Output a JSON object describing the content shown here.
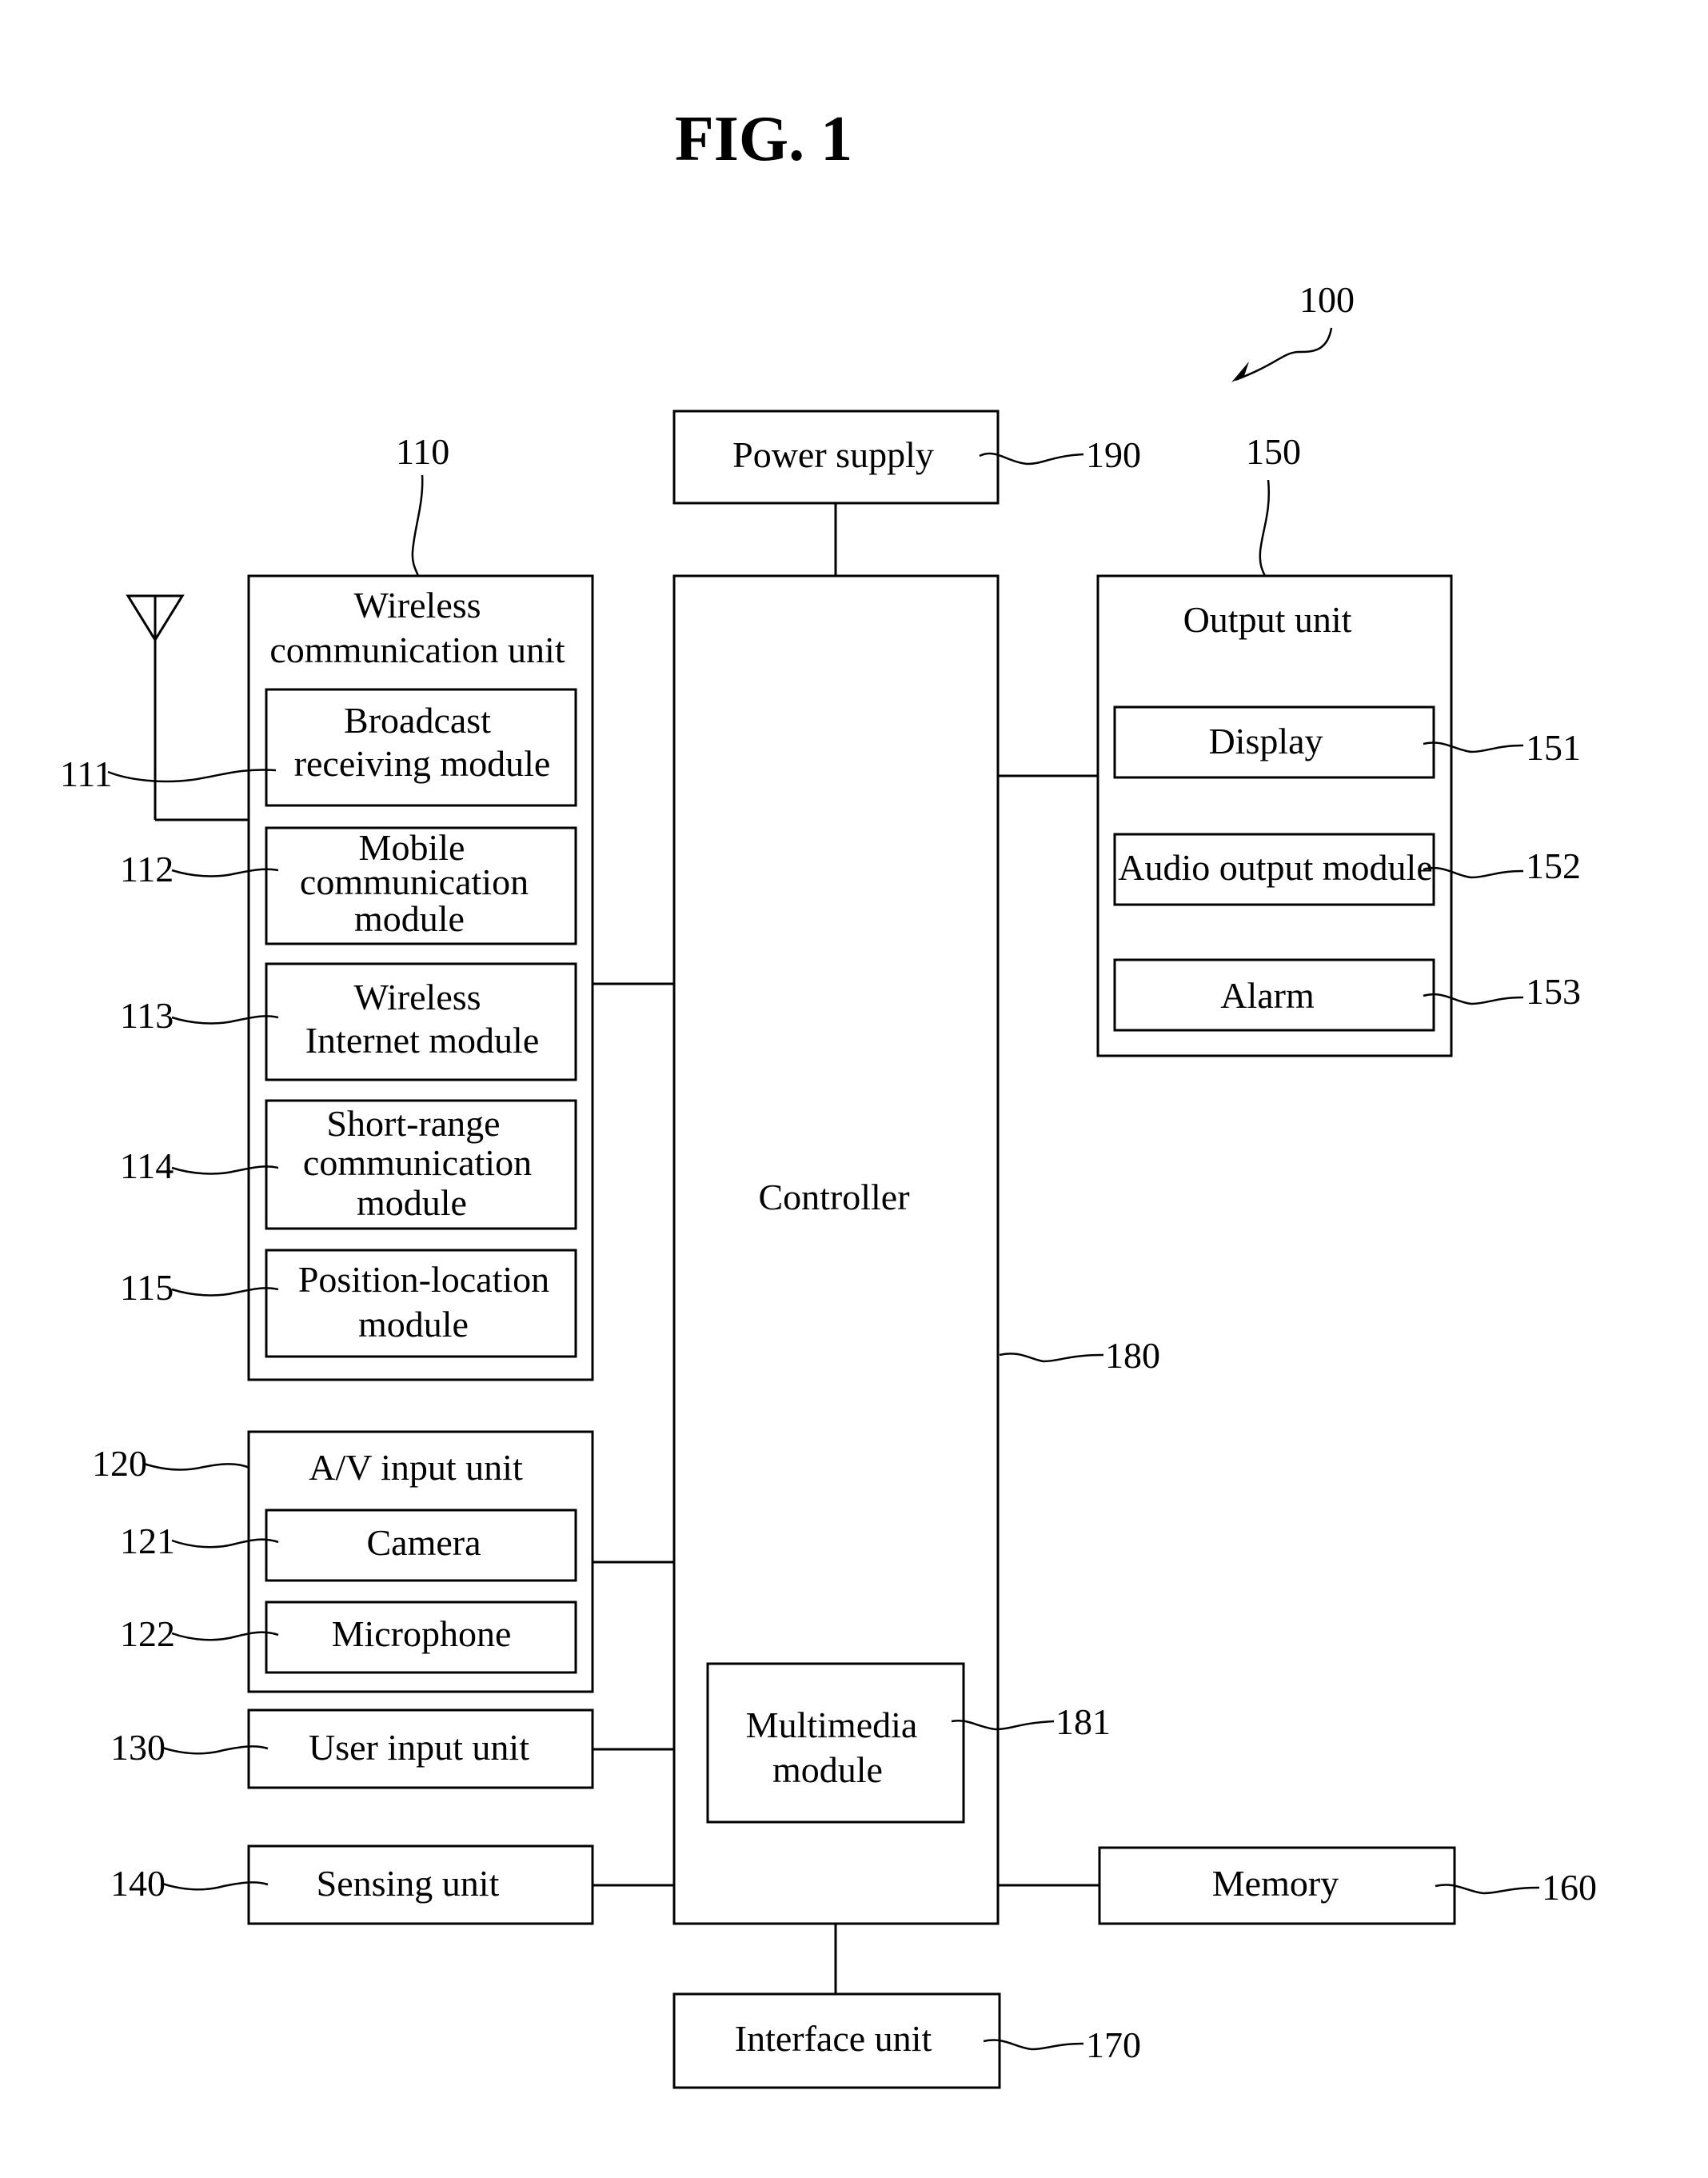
{
  "figure": {
    "title": "FIG. 1",
    "device_ref": "100"
  },
  "blocks": {
    "power_supply": {
      "label": "Power supply",
      "ref": "190"
    },
    "controller": {
      "label": "Controller",
      "ref": "180"
    },
    "multimedia": {
      "label_lines": [
        "Multimedia",
        "module"
      ],
      "ref": "181"
    },
    "wireless_unit": {
      "label_lines": [
        "Wireless",
        "communication unit"
      ],
      "ref": "110",
      "modules": [
        {
          "label_lines": [
            "Broadcast",
            "receiving module"
          ],
          "ref": "111"
        },
        {
          "label_lines": [
            "Mobile",
            "communication",
            "module"
          ],
          "ref": "112"
        },
        {
          "label_lines": [
            "Wireless",
            "Internet module"
          ],
          "ref": "113"
        },
        {
          "label_lines": [
            "Short-range",
            "communication",
            "module"
          ],
          "ref": "114"
        },
        {
          "label_lines": [
            "Position-location",
            "module"
          ],
          "ref": "115"
        }
      ]
    },
    "av_input": {
      "label": "A/V input unit",
      "ref": "120",
      "modules": [
        {
          "label": "Camera",
          "ref": "121"
        },
        {
          "label": "Microphone",
          "ref": "122"
        }
      ]
    },
    "user_input": {
      "label": "User input unit",
      "ref": "130"
    },
    "sensing": {
      "label": "Sensing unit",
      "ref": "140"
    },
    "output_unit": {
      "label": "Output unit",
      "ref": "150",
      "modules": [
        {
          "label": "Display",
          "ref": "151"
        },
        {
          "label": "Audio output module",
          "ref": "152"
        },
        {
          "label": "Alarm",
          "ref": "153"
        }
      ]
    },
    "memory": {
      "label": "Memory",
      "ref": "160"
    },
    "interface": {
      "label": "Interface unit",
      "ref": "170"
    }
  }
}
